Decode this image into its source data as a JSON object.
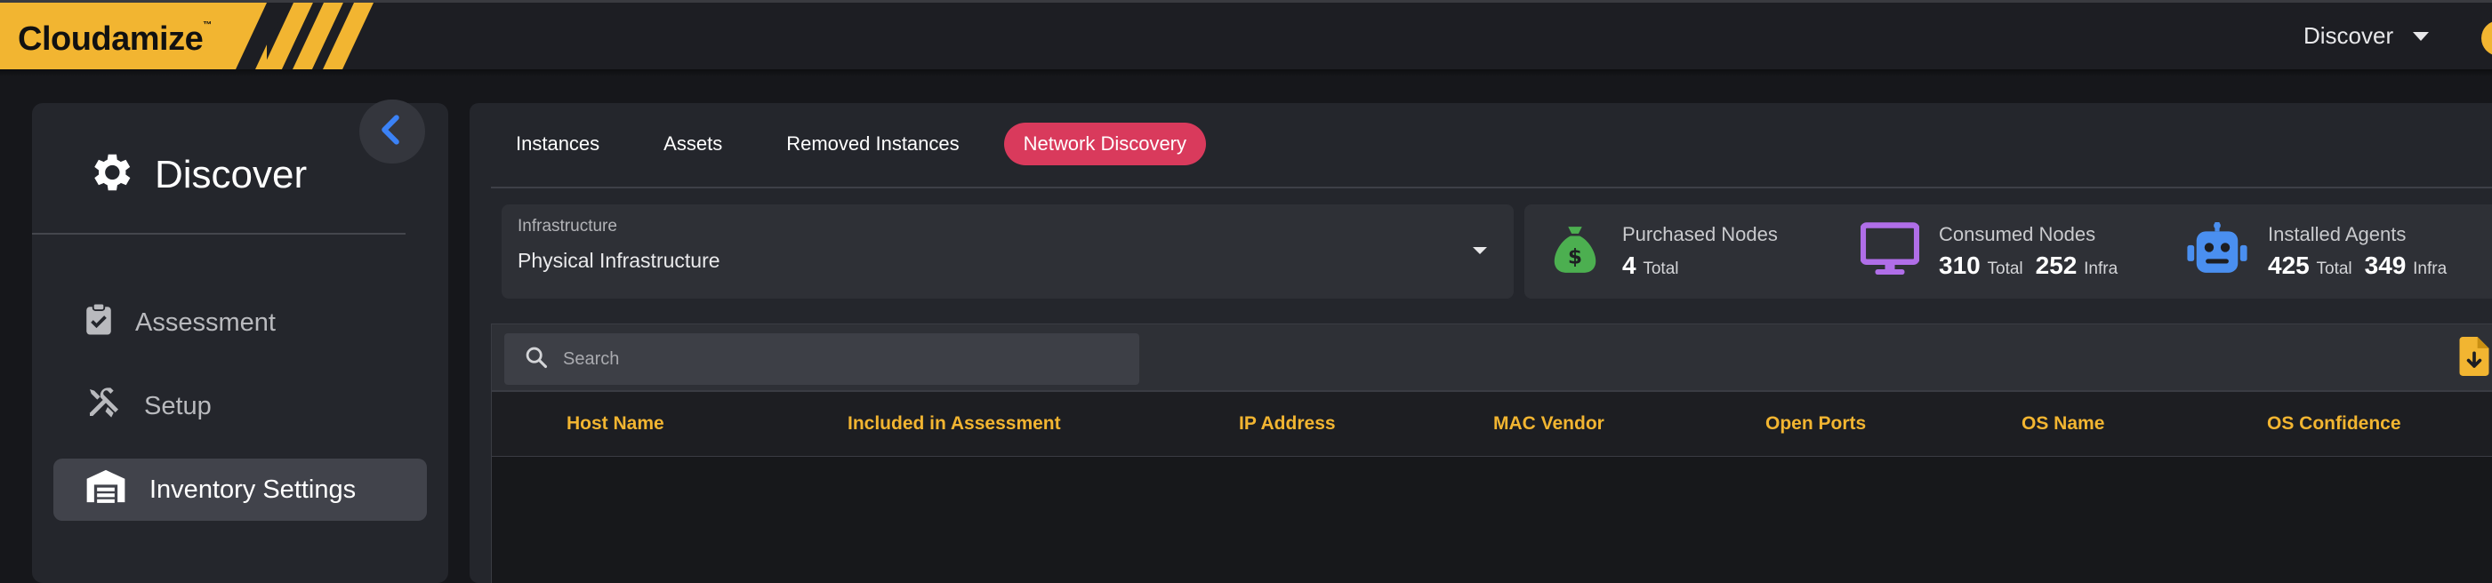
{
  "app": {
    "logo_text": "Cloudamize",
    "top_menu_label": "Discover"
  },
  "sidebar": {
    "title": "Discover",
    "items": [
      {
        "label": "Assessment",
        "active": false
      },
      {
        "label": "Setup",
        "active": false
      },
      {
        "label": "Inventory Settings",
        "active": true
      }
    ]
  },
  "tabs": [
    {
      "label": "Instances",
      "active": false
    },
    {
      "label": "Assets",
      "active": false
    },
    {
      "label": "Removed Instances",
      "active": false
    },
    {
      "label": "Network Discovery",
      "active": true
    }
  ],
  "infrastructure": {
    "label": "Infrastructure",
    "value": "Physical Infrastructure"
  },
  "stats": {
    "purchased": {
      "title": "Purchased Nodes",
      "total": "4",
      "total_unit": "Total"
    },
    "consumed": {
      "title": "Consumed Nodes",
      "total": "310",
      "total_unit": "Total",
      "infra": "252",
      "infra_unit": "Infra"
    },
    "agents": {
      "title": "Installed Agents",
      "total": "425",
      "total_unit": "Total",
      "infra": "349",
      "infra_unit": "Infra"
    }
  },
  "search": {
    "placeholder": "Search",
    "value": ""
  },
  "table": {
    "columns": [
      "Host Name",
      "Included in Assessment",
      "IP Address",
      "MAC Vendor",
      "Open Ports",
      "OS Name",
      "OS Confidence"
    ],
    "rows": []
  },
  "colors": {
    "brand": "#f2b531",
    "accent_tab": "#d93a5c",
    "header_text": "#f2b531",
    "money_icon": "#4caf50",
    "monitor_icon": "#b06ee8",
    "robot_icon": "#4a8ff0",
    "collapse_chevron": "#3b82f6"
  },
  "icons": {
    "sidebar_header": "gear-icon",
    "assessment": "clipboard-check-icon",
    "setup": "tools-icon",
    "inventory": "warehouse-icon",
    "collapse": "chevron-left-icon",
    "purchased": "money-bag-icon",
    "consumed": "monitor-icon",
    "agents": "robot-icon",
    "search": "search-icon",
    "export": "file-download-icon"
  }
}
